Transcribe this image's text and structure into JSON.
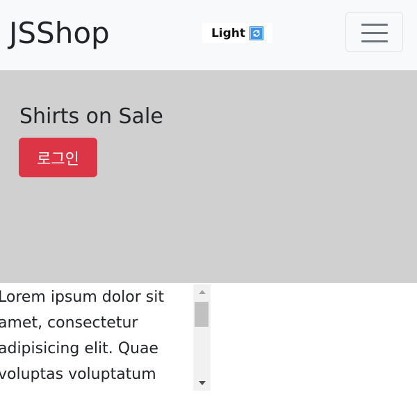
{
  "navbar": {
    "brand": "JSShop",
    "theme_toggle_label": "Light",
    "theme_icon": "refresh-icon",
    "menu_icon": "hamburger-menu-icon"
  },
  "hero": {
    "title": "Shirts on Sale",
    "login_button": "로그인"
  },
  "text_box": {
    "content": "Lorem ipsum dolor sit amet, consectetur adipisicing elit. Quae voluptas voluptatum",
    "scroll_position": 0.0
  },
  "colors": {
    "navbar_bg": "#f8f9fa",
    "hero_bg": "#d0d0d0",
    "login_button_bg": "#dc3545",
    "theme_icon_bg": "#1e7ad6"
  }
}
